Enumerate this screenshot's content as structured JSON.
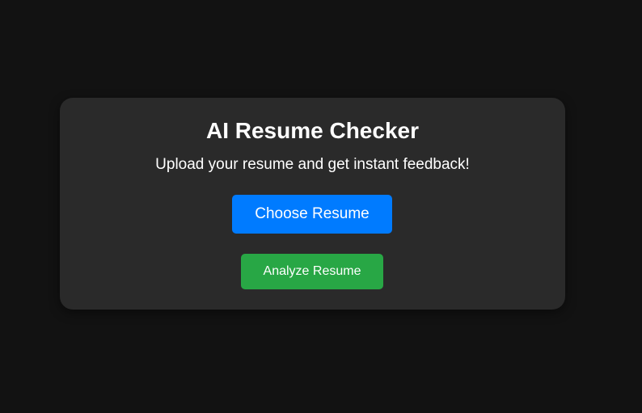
{
  "card": {
    "title": "AI Resume Checker",
    "subtitle": "Upload your resume and get instant feedback!",
    "choose_label": "Choose Resume",
    "analyze_label": "Analyze Resume"
  },
  "colors": {
    "page_background": "#121212",
    "card_background": "#2a2a2a",
    "choose_button": "#007bff",
    "analyze_button": "#28a745",
    "text": "#ffffff"
  }
}
